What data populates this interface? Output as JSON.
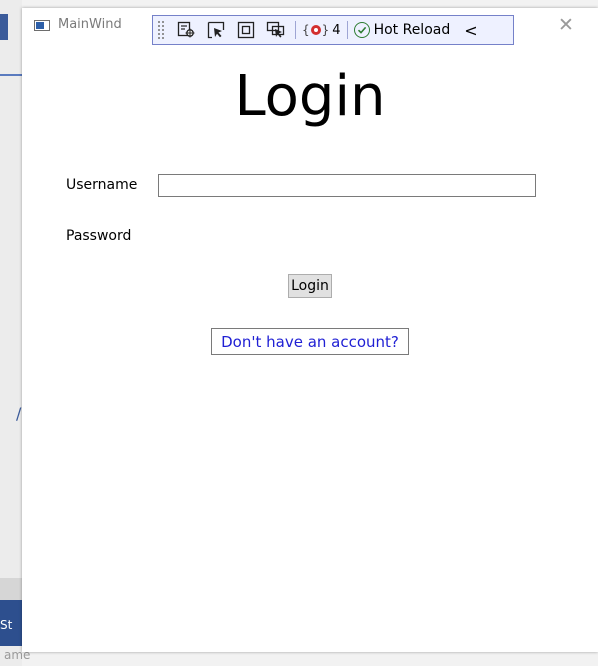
{
  "window": {
    "title": "MainWind",
    "close_glyph": "✕"
  },
  "devbar": {
    "error_count": "4",
    "hot_reload_label": "Hot Reload",
    "collapse_glyph": "<"
  },
  "login": {
    "heading": "Login",
    "username_label": "Username",
    "username_value": "",
    "password_label": "Password",
    "login_button_label": "Login",
    "account_link_label": "Don't have an account?"
  },
  "background": {
    "left_edge_text": "St",
    "bottom_text": "ame"
  },
  "colors": {
    "link": "#1f1fd4",
    "devbar_border": "#7581c9",
    "hot_reload_ok": "#2e7d32",
    "error": "#d32f2f"
  }
}
